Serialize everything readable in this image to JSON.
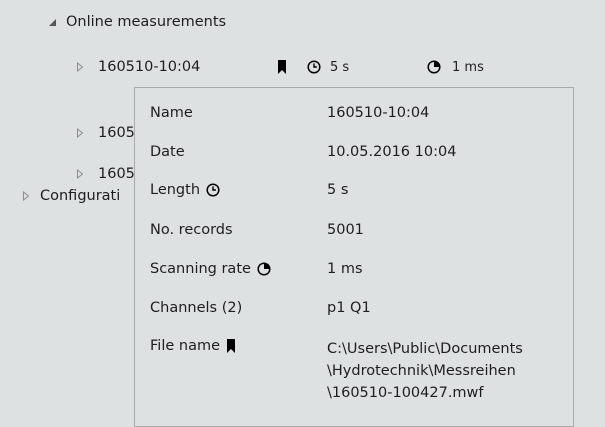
{
  "tree": {
    "online_group": {
      "label": "Online measurements"
    },
    "items": [
      {
        "label": "160510-10:04",
        "length": "5 s",
        "scanning_rate": "1 ms"
      },
      {
        "label": "1605"
      },
      {
        "label": "1605"
      }
    ],
    "config_group": {
      "label": "Configurati"
    }
  },
  "tooltip": {
    "name_label": "Name",
    "name_value": "160510-10:04",
    "date_label": "Date",
    "date_value": "10.05.2016 10:04",
    "length_label": "Length",
    "length_value": "5 s",
    "records_label": "No. records",
    "records_value": "5001",
    "rate_label": "Scanning rate",
    "rate_value": "1 ms",
    "channels_label": "Channels (2)",
    "channels_value": "p1 Q1",
    "file_label": "File name",
    "file_value": [
      "C:\\Users\\Public\\Documents",
      "\\Hydrotechnik\\Messreihen",
      "\\160510-100427.mwf"
    ]
  },
  "icons": {
    "expanded": "triangle-down-icon",
    "collapsed": "triangle-right-icon",
    "bookmark": "bookmark-icon",
    "clock": "clock-icon",
    "rate": "pie-chart-icon"
  }
}
